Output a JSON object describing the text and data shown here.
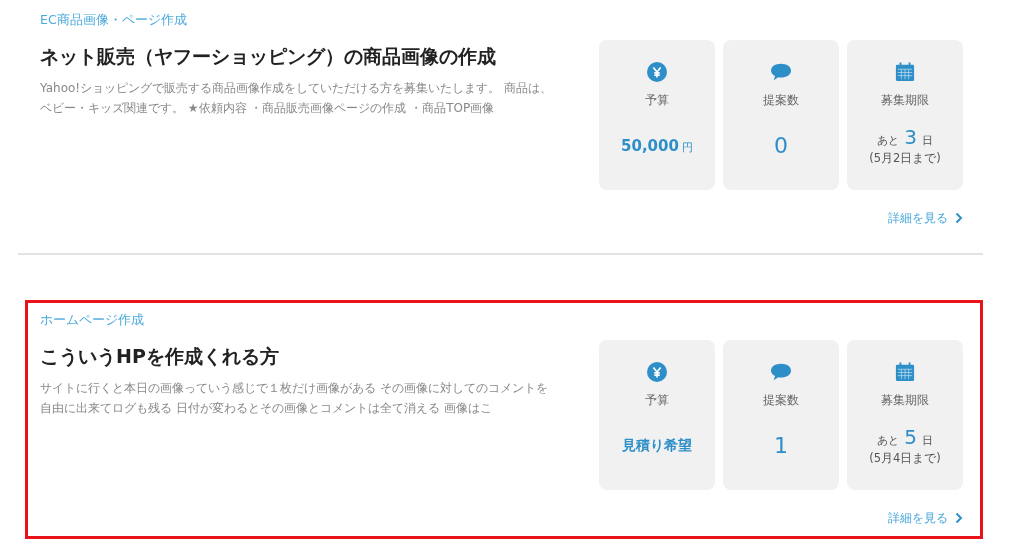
{
  "jobs": [
    {
      "highlighted": false,
      "category": "EC商品画像・ページ作成",
      "title": "ネット販売（ヤフーショッピング）の商品画像の作成",
      "description": "Yahoo!ショッピングで販売する商品画像作成をしていただける方を募集いたします。 商品は、ベビー・キッズ関連です。 ★依頼内容 ・商品販売画像ページの作成 ・商品TOP画像",
      "budget": {
        "label": "予算",
        "value": "50,000",
        "unit": "円"
      },
      "proposals": {
        "label": "提案数",
        "value": "0"
      },
      "deadline": {
        "label": "募集期限",
        "prefix": "あと",
        "days": "3",
        "suffix": "日",
        "date": "(5月2日まで)"
      },
      "detail_link": "詳細を見る"
    },
    {
      "highlighted": true,
      "category": "ホームページ作成",
      "title": "こういうHPを作成くれる方",
      "description": "サイトに行くと本日の画像っていう感じで１枚だけ画像がある その画像に対してのコメントを自由に出来てログも残る 日付が変わるとその画像とコメントは全て消える 画像はこ",
      "budget": {
        "label": "予算",
        "value": "見積り希望"
      },
      "proposals": {
        "label": "提案数",
        "value": "1"
      },
      "deadline": {
        "label": "募集期限",
        "prefix": "あと",
        "days": "5",
        "suffix": "日",
        "date": "(5月4日まで)"
      },
      "detail_link": "詳細を見る"
    }
  ]
}
